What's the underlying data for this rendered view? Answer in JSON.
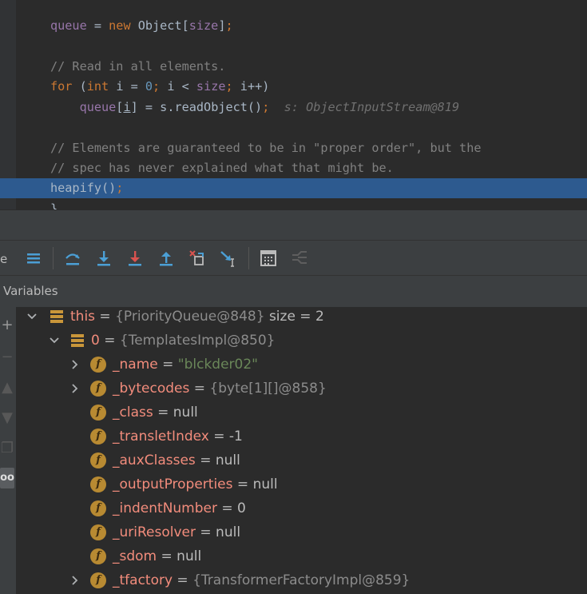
{
  "editor": {
    "lines": [
      {
        "parts": [
          {
            "t": "queue",
            "c": "fld"
          },
          {
            "t": " = ",
            "c": ""
          },
          {
            "t": "new",
            "c": "kw"
          },
          {
            "t": " Object[",
            "c": ""
          },
          {
            "t": "size",
            "c": "fld"
          },
          {
            "t": "]",
            "c": ""
          },
          {
            "t": ";",
            "c": "kw"
          }
        ]
      },
      {
        "parts": []
      },
      {
        "parts": [
          {
            "t": "// Read in all elements.",
            "c": "cmt"
          }
        ]
      },
      {
        "parts": [
          {
            "t": "for",
            "c": "kw"
          },
          {
            "t": " (",
            "c": ""
          },
          {
            "t": "int",
            "c": "kw"
          },
          {
            "t": " i = ",
            "c": ""
          },
          {
            "t": "0",
            "c": "num"
          },
          {
            "t": "; ",
            "c": "kw"
          },
          {
            "t": "i < ",
            "c": ""
          },
          {
            "t": "size",
            "c": "fld"
          },
          {
            "t": "; ",
            "c": "kw"
          },
          {
            "t": "i++)",
            "c": ""
          }
        ]
      },
      {
        "parts": [
          {
            "t": "    ",
            "c": ""
          },
          {
            "t": "queue",
            "c": "fld"
          },
          {
            "t": "[",
            "c": ""
          },
          {
            "t": "i",
            "c": "ul"
          },
          {
            "t": "] = s.readObject()",
            "c": ""
          },
          {
            "t": ";",
            "c": "kw"
          },
          {
            "t": "  s: ObjectInputStream@819",
            "c": "hint"
          }
        ]
      },
      {
        "parts": []
      },
      {
        "parts": [
          {
            "t": "// Elements are guaranteed to be in \"proper order\", but the",
            "c": "cmt"
          }
        ]
      },
      {
        "parts": [
          {
            "t": "// spec has never explained what that might be.",
            "c": "cmt"
          }
        ]
      },
      {
        "parts": [
          {
            "t": "heapify()",
            "c": ""
          },
          {
            "t": ";",
            "c": "kw"
          }
        ],
        "current": true
      },
      {
        "parts": [
          {
            "t": "}",
            "c": ""
          }
        ]
      }
    ]
  },
  "toolbar": {
    "cut_label": "e",
    "buttons": [
      {
        "name": "show-execution-point-icon"
      },
      {
        "name": "step-over-icon"
      },
      {
        "name": "step-into-icon"
      },
      {
        "name": "force-step-into-icon"
      },
      {
        "name": "step-out-icon"
      },
      {
        "name": "drop-frame-icon"
      },
      {
        "name": "run-to-cursor-icon"
      },
      {
        "name": "evaluate-expression-icon"
      },
      {
        "name": "trace-current-stream-chain-icon"
      }
    ]
  },
  "variables": {
    "title": "Variables",
    "rows": [
      {
        "depth": 0,
        "expand": "down",
        "icon": "object",
        "name": "this",
        "eq": " = ",
        "ref": "{PriorityQueue@848}",
        "extra": "size = 2",
        "kind": "ref"
      },
      {
        "depth": 1,
        "expand": "down",
        "icon": "object",
        "name": "0",
        "eq": " = ",
        "ref": "{TemplatesImpl@850}",
        "kind": "ref"
      },
      {
        "depth": 2,
        "expand": "right",
        "icon": "field",
        "name": "_name",
        "eq": " = ",
        "value": "\"blckder02\"",
        "kind": "str"
      },
      {
        "depth": 2,
        "expand": "right",
        "icon": "field",
        "name": "_bytecodes",
        "eq": " = ",
        "ref": "{byte[1][]@858}",
        "kind": "ref"
      },
      {
        "depth": 2,
        "expand": "none",
        "icon": "field",
        "name": "_class",
        "eq": " = ",
        "value": "null",
        "kind": "val"
      },
      {
        "depth": 2,
        "expand": "none",
        "icon": "field",
        "name": "_transletIndex",
        "eq": " = ",
        "value": "-1",
        "kind": "val"
      },
      {
        "depth": 2,
        "expand": "none",
        "icon": "field",
        "name": "_auxClasses",
        "eq": " = ",
        "value": "null",
        "kind": "val"
      },
      {
        "depth": 2,
        "expand": "none",
        "icon": "field",
        "name": "_outputProperties",
        "eq": " = ",
        "value": "null",
        "kind": "val"
      },
      {
        "depth": 2,
        "expand": "none",
        "icon": "field",
        "name": "_indentNumber",
        "eq": " = ",
        "value": "0",
        "kind": "val"
      },
      {
        "depth": 2,
        "expand": "none",
        "icon": "field",
        "name": "_uriResolver",
        "eq": " = ",
        "value": "null",
        "kind": "val"
      },
      {
        "depth": 2,
        "expand": "none",
        "icon": "field",
        "name": "_sdom",
        "eq": " = ",
        "value": "null",
        "kind": "val"
      },
      {
        "depth": 2,
        "expand": "right",
        "icon": "field",
        "name": "_tfactory",
        "eq": " = ",
        "ref": "{TransformerFactoryImpl@859}",
        "kind": "ref"
      }
    ]
  },
  "side_icons": [
    {
      "name": "add-watch-icon",
      "glyph": "+"
    },
    {
      "name": "remove-watch-icon",
      "glyph": "−"
    },
    {
      "name": "move-up-icon",
      "glyph": "▲"
    },
    {
      "name": "move-down-icon",
      "glyph": "▼"
    },
    {
      "name": "copy-icon",
      "glyph": "❐"
    },
    {
      "name": "show-watches-icon",
      "glyph": "oo"
    }
  ]
}
